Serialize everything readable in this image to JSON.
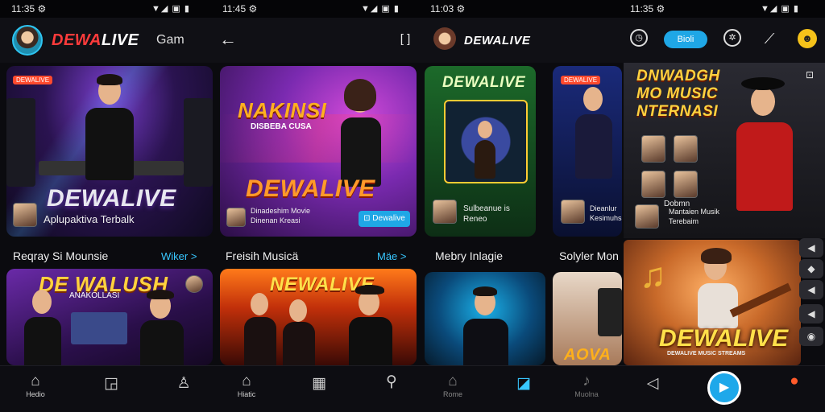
{
  "status": {
    "time1": "11:35 ⚙",
    "time2": "11:45 ⚙",
    "time3": "11:03 ⚙",
    "time4": "11:35 ⚙",
    "icons1": "▼◢ ▣ ▮",
    "icons2": "▼◢ ▣ ▮",
    "icons3": "▼◢ ▣ ▮"
  },
  "screen1": {
    "brand_a": "DEWA",
    "brand_b": "LIVE",
    "header_text": "Gam",
    "hero_title": "DEWALIVE",
    "hero_sub": "Aplupaktiva Terbalk",
    "hero_tag": "DEWALIVE",
    "section_title": "Reqray Si Mounsie",
    "section_more": "Wiker >",
    "card2_title": "DE WALUSH",
    "card2_sub": "ANAKOLLASI"
  },
  "screen2": {
    "back_icon": "←",
    "expand_icon": "[ ]",
    "hero_title_top": "NAKINSI",
    "hero_title_mid": "DISBEBA CUSA",
    "hero_title": "DEWALIVE",
    "hero_sub": "Dinadeshim Movie",
    "hero_sub2": "Dinenan Kreasi",
    "hero_button": "⊡ Dewalive",
    "section_title": "Freisih Musicä",
    "section_more": "Mäe >",
    "card2_title": "NEWALIVE"
  },
  "screen3": {
    "brand": "DEWALIVE",
    "pill_label": "Bioli",
    "hero_title": "DEWALIVE",
    "hero_sub": "Sulbeanue is",
    "hero_sub2": "Reneo",
    "section_title": "Mebry Inlagie",
    "card_side_sub": "Dieanlur",
    "card_side_sub2": "Kesimuhs"
  },
  "screen4": {
    "hero_title_1": "DNWADGH",
    "hero_title_2": "MO MUSIC",
    "hero_title_3": "NTERNASI",
    "hero_sub": "Dobmn",
    "hero_sub2": "Mantaien Musik",
    "hero_sub3": "Terebaim",
    "section_title": "Solyler Mon",
    "card_title": "DEWALIVE",
    "card_sub": "DEWALIVE MUSIC STREAMS",
    "card_bottom": "AOVA",
    "side_icons": [
      "◀",
      "◆",
      "◀",
      "◉"
    ]
  },
  "nav": {
    "home_label": "Hedio",
    "home2_label": "Hiatic",
    "home3_label": "Rome",
    "music_label": "Muolna"
  },
  "colors": {
    "accent_red": "#ff3b3b",
    "accent_blue": "#1fa7e6",
    "bg": "#0b0b0f"
  }
}
